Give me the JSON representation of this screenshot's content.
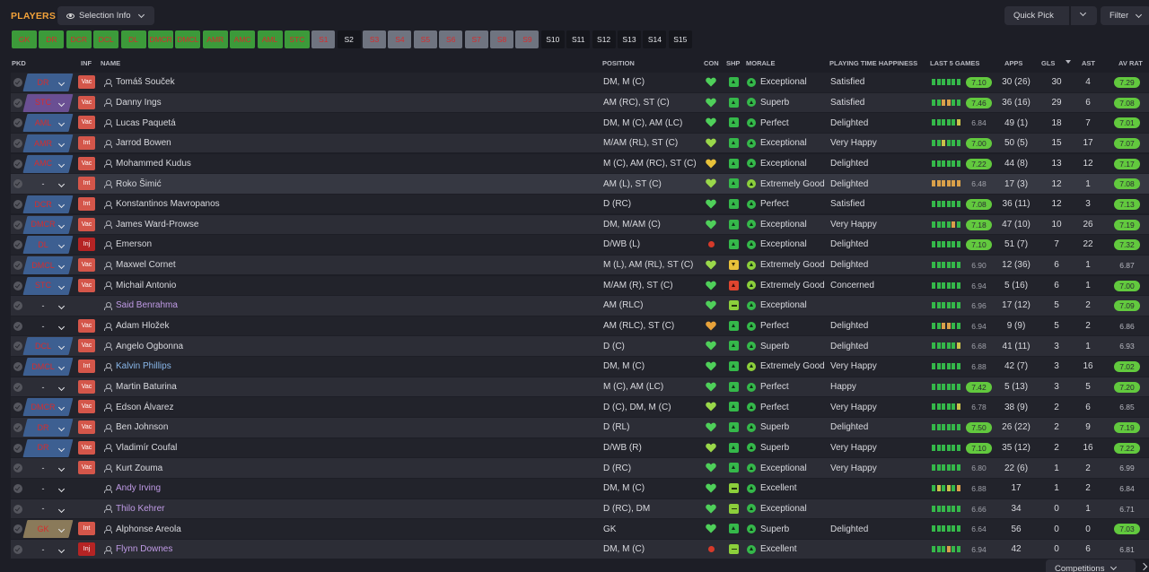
{
  "header": {
    "title": "PLAYERS",
    "selection_info_label": "Selection Info",
    "quick_pick_label": "Quick Pick",
    "filter_label": "Filter",
    "competitions_label": "Competitions"
  },
  "colors": {
    "accent": "#f2a23a",
    "rating_green": "#62c93e",
    "position_blue": "#3d5f91",
    "position_red_text": "#d62d2d",
    "status_red": "#d4564a"
  },
  "slots": [
    {
      "label": "GK",
      "style": "green",
      "w": 28
    },
    {
      "label": "DR",
      "style": "green",
      "w": 28
    },
    {
      "label": "DCR",
      "style": "green",
      "w": 28
    },
    {
      "label": "DCL",
      "style": "green",
      "w": 28
    },
    {
      "label": "DL",
      "style": "green",
      "w": 28
    },
    {
      "label": "DMCR",
      "style": "green",
      "w": 28
    },
    {
      "label": "DMCL",
      "style": "green",
      "w": 28
    },
    {
      "label": "AMR",
      "style": "green",
      "w": 28
    },
    {
      "label": "AMC",
      "style": "green",
      "w": 28
    },
    {
      "label": "AML",
      "style": "green",
      "w": 28
    },
    {
      "label": "STC",
      "style": "green",
      "w": 28
    },
    {
      "label": "S1",
      "style": "grey",
      "w": 26
    },
    {
      "label": "S2",
      "style": "dark",
      "w": 26
    },
    {
      "label": "S3",
      "style": "grey",
      "w": 26
    },
    {
      "label": "S4",
      "style": "grey",
      "w": 26
    },
    {
      "label": "S5",
      "style": "grey",
      "w": 26
    },
    {
      "label": "S6",
      "style": "grey",
      "w": 26
    },
    {
      "label": "S7",
      "style": "grey",
      "w": 26
    },
    {
      "label": "S8",
      "style": "grey",
      "w": 26
    },
    {
      "label": "S9",
      "style": "grey",
      "w": 26
    },
    {
      "label": "S10",
      "style": "dark",
      "w": 26
    },
    {
      "label": "S11",
      "style": "dark",
      "w": 26
    },
    {
      "label": "S12",
      "style": "dark",
      "w": 26
    },
    {
      "label": "S13",
      "style": "dark",
      "w": 26
    },
    {
      "label": "S14",
      "style": "dark",
      "w": 26
    },
    {
      "label": "S15",
      "style": "dark",
      "w": 26
    }
  ],
  "columns": {
    "pkd": "PKD",
    "inf": "INF",
    "name": "NAME",
    "position": "POSITION",
    "con": "CON",
    "shp": "SHP",
    "morale": "MORALE",
    "playing_time": "PLAYING TIME HAPPINESS",
    "last5": "LAST 5 GAMES",
    "apps": "APPS",
    "gls": "GLS",
    "ast": "AST",
    "avrat": "AV RAT"
  },
  "players": [
    {
      "pick": "DR",
      "pick_style": "blue",
      "inf": "Vac",
      "name": "Tomáš Souček",
      "name_style": "",
      "position": "DM, M (C)",
      "heart": "#4fd05a",
      "shp": "g",
      "morale": "Exceptional",
      "pth": "Satisfied",
      "form": "gggggg",
      "l5": "7.10",
      "l5s": "g",
      "apps": "30 (26)",
      "gls": "30",
      "ast": "4",
      "avr": "7.29",
      "avrs": "g"
    },
    {
      "pick": "STC",
      "pick_style": "st",
      "inf": "Vac",
      "name": "Danny Ings",
      "name_style": "",
      "position": "AM (RC), ST (C)",
      "heart": "#4fd05a",
      "shp": "g",
      "morale": "Superb",
      "pth": "Satisfied",
      "form": "ggoogg",
      "l5": "7.46",
      "l5s": "g",
      "apps": "36 (16)",
      "gls": "29",
      "ast": "6",
      "avr": "7.08",
      "avrs": "g"
    },
    {
      "pick": "AML",
      "pick_style": "blue",
      "inf": "Vac",
      "name": "Lucas Paquetá",
      "name_style": "",
      "position": "DM, M (C), AM (LC)",
      "heart": "#4fd05a",
      "shp": "g",
      "morale": "Perfect",
      "pth": "Delighted",
      "form": "gggggy",
      "l5": "6.84",
      "l5s": "n",
      "apps": "49 (1)",
      "gls": "18",
      "ast": "7",
      "avr": "7.01",
      "avrs": "g"
    },
    {
      "pick": "AMR",
      "pick_style": "blue",
      "inf": "Int",
      "name": "Jarrod Bowen",
      "name_style": "",
      "position": "M/AM (RL), ST (C)",
      "heart": "#9ad84a",
      "shp": "g",
      "morale": "Exceptional",
      "pth": "Very Happy",
      "form": "ggyggg",
      "l5": "7.00",
      "l5s": "g",
      "apps": "50 (5)",
      "gls": "15",
      "ast": "17",
      "avr": "7.07",
      "avrs": "g"
    },
    {
      "pick": "AMC",
      "pick_style": "blue",
      "inf": "Vac",
      "name": "Mohammed Kudus",
      "name_style": "",
      "position": "M (C), AM (RC), ST (C)",
      "heart": "#e8c23a",
      "shp": "g",
      "morale": "Exceptional",
      "pth": "Delighted",
      "form": "gggggg",
      "l5": "7.22",
      "l5s": "g",
      "apps": "44 (8)",
      "gls": "13",
      "ast": "12",
      "avr": "7.17",
      "avrs": "g"
    },
    {
      "pick": "-",
      "pick_style": "plain",
      "inf": "Int",
      "name": "Roko Šimić",
      "name_style": "",
      "position": "AM (L), ST (C)",
      "heart": "#9ad84a",
      "shp": "g",
      "morale": "Extremely Good",
      "moraleStyle": "eg",
      "pth": "Delighted",
      "form": "oooooo",
      "l5": "6.48",
      "l5s": "n",
      "apps": "17 (3)",
      "gls": "12",
      "ast": "1",
      "avr": "7.08",
      "avrs": "g",
      "hl": true
    },
    {
      "pick": "DCR",
      "pick_style": "blue",
      "inf": "Int",
      "name": "Konstantinos Mavropanos",
      "name_style": "",
      "position": "D (RC)",
      "heart": "#4fd05a",
      "shp": "g",
      "morale": "Perfect",
      "pth": "Satisfied",
      "form": "gggggg",
      "l5": "7.08",
      "l5s": "g",
      "apps": "36 (11)",
      "gls": "12",
      "ast": "3",
      "avr": "7.13",
      "avrs": "g"
    },
    {
      "pick": "DMCR",
      "pick_style": "blue",
      "inf": "Vac",
      "name": "James Ward-Prowse",
      "name_style": "",
      "position": "DM, M/AM (C)",
      "heart": "#4fd05a",
      "shp": "g",
      "morale": "Exceptional",
      "pth": "Very Happy",
      "form": "ggggog",
      "l5": "7.18",
      "l5s": "g",
      "apps": "47 (10)",
      "gls": "10",
      "ast": "26",
      "avr": "7.19",
      "avrs": "g"
    },
    {
      "pick": "DL",
      "pick_style": "blue",
      "inf": "Inj",
      "name": "Emerson",
      "name_style": "",
      "position": "D/WB (L)",
      "heart": "#d63a2a",
      "shp": "g",
      "morale": "Exceptional",
      "pth": "Delighted",
      "form": "gggggg",
      "l5": "7.10",
      "l5s": "g",
      "apps": "51 (7)",
      "gls": "7",
      "ast": "22",
      "avr": "7.32",
      "avrs": "g",
      "dot": true
    },
    {
      "pick": "DMCL",
      "pick_style": "blue",
      "inf": "Vac",
      "name": "Maxwel Cornet",
      "name_style": "",
      "position": "M (L), AM (RL), ST (C)",
      "heart": "#9ad84a",
      "shp": "y",
      "morale": "Extremely Good",
      "moraleStyle": "eg",
      "pth": "Delighted",
      "form": "gggggg",
      "l5": "6.90",
      "l5s": "n",
      "apps": "12 (36)",
      "gls": "6",
      "ast": "1",
      "avr": "6.87",
      "avrs": "n"
    },
    {
      "pick": "STC",
      "pick_style": "blue",
      "inf": "Vac",
      "name": "Michail Antonio",
      "name_style": "",
      "position": "M/AM (R), ST (C)",
      "heart": "#4fd05a",
      "shp": "r",
      "morale": "Extremely Good",
      "moraleStyle": "eg",
      "pth": "Concerned",
      "form": "gggggg",
      "l5": "6.94",
      "l5s": "n",
      "apps": "5 (16)",
      "gls": "6",
      "ast": "1",
      "avr": "7.00",
      "avrs": "g"
    },
    {
      "pick": "-",
      "pick_style": "plain",
      "inf": "",
      "name": "Said Benrahma",
      "name_style": "loan",
      "position": "AM (RLC)",
      "heart": "#4fd05a",
      "shp": "m",
      "morale": "Exceptional",
      "pth": "",
      "form": "gggggg",
      "l5": "6.96",
      "l5s": "n",
      "apps": "17 (12)",
      "gls": "5",
      "ast": "2",
      "avr": "7.09",
      "avrs": "g"
    },
    {
      "pick": "-",
      "pick_style": "plain",
      "inf": "Vac",
      "name": "Adam Hložek",
      "name_style": "",
      "position": "AM (RLC), ST (C)",
      "heart": "#e8a23a",
      "shp": "g",
      "morale": "Perfect",
      "pth": "Delighted",
      "form": "ggoogg",
      "l5": "6.94",
      "l5s": "n",
      "apps": "9 (9)",
      "gls": "5",
      "ast": "2",
      "avr": "6.86",
      "avrs": "n"
    },
    {
      "pick": "DCL",
      "pick_style": "blue",
      "inf": "Vac",
      "name": "Angelo Ogbonna",
      "name_style": "",
      "position": "D (C)",
      "heart": "#4fd05a",
      "shp": "g",
      "morale": "Superb",
      "pth": "Delighted",
      "form": "gggggy",
      "l5": "6.68",
      "l5s": "n",
      "apps": "41 (11)",
      "gls": "3",
      "ast": "1",
      "avr": "6.93",
      "avrs": "n"
    },
    {
      "pick": "DMCL",
      "pick_style": "blue",
      "inf": "Int",
      "name": "Kalvin Phillips",
      "name_style": "blue",
      "position": "DM, M (C)",
      "heart": "#4fd05a",
      "shp": "g",
      "morale": "Extremely Good",
      "moraleStyle": "eg",
      "pth": "Very Happy",
      "form": "gggggg",
      "l5": "6.88",
      "l5s": "n",
      "apps": "42 (7)",
      "gls": "3",
      "ast": "16",
      "avr": "7.02",
      "avrs": "g"
    },
    {
      "pick": "-",
      "pick_style": "plain",
      "inf": "Vac",
      "name": "Martin Baturina",
      "name_style": "",
      "position": "M (C), AM (LC)",
      "heart": "#4fd05a",
      "shp": "g",
      "morale": "Perfect",
      "pth": "Happy",
      "form": "gggggg",
      "l5": "7.42",
      "l5s": "g",
      "apps": "5 (13)",
      "gls": "3",
      "ast": "5",
      "avr": "7.20",
      "avrs": "g"
    },
    {
      "pick": "DMCR",
      "pick_style": "blue",
      "inf": "Vac",
      "name": "Edson Álvarez",
      "name_style": "",
      "position": "D (C), DM, M (C)",
      "heart": "#9ad84a",
      "shp": "g",
      "morale": "Perfect",
      "pth": "Very Happy",
      "form": "gggggy",
      "l5": "6.78",
      "l5s": "n",
      "apps": "38 (9)",
      "gls": "2",
      "ast": "6",
      "avr": "6.85",
      "avrs": "n"
    },
    {
      "pick": "DR",
      "pick_style": "blue",
      "inf": "Vac",
      "name": "Ben Johnson",
      "name_style": "",
      "position": "D (RL)",
      "heart": "#4fd05a",
      "shp": "g",
      "morale": "Superb",
      "pth": "Delighted",
      "form": "gggggg",
      "l5": "7.50",
      "l5s": "g",
      "apps": "26 (22)",
      "gls": "2",
      "ast": "9",
      "avr": "7.19",
      "avrs": "g"
    },
    {
      "pick": "DR",
      "pick_style": "blue",
      "inf": "Vac",
      "name": "Vladimír Coufal",
      "name_style": "",
      "position": "D/WB (R)",
      "heart": "#9ad84a",
      "shp": "g",
      "morale": "Superb",
      "pth": "Very Happy",
      "form": "gggggg",
      "l5": "7.10",
      "l5s": "g",
      "apps": "35 (12)",
      "gls": "2",
      "ast": "16",
      "avr": "7.22",
      "avrs": "g"
    },
    {
      "pick": "-",
      "pick_style": "plain",
      "inf": "Vac",
      "name": "Kurt Zouma",
      "name_style": "",
      "position": "D (RC)",
      "heart": "#4fd05a",
      "shp": "g",
      "morale": "Exceptional",
      "pth": "Very Happy",
      "form": "gggggg",
      "l5": "6.80",
      "l5s": "n",
      "apps": "22 (6)",
      "gls": "1",
      "ast": "2",
      "avr": "6.99",
      "avrs": "n"
    },
    {
      "pick": "-",
      "pick_style": "plain",
      "inf": "",
      "name": "Andy Irving",
      "name_style": "loan",
      "position": "DM, M (C)",
      "heart": "#4fd05a",
      "shp": "m",
      "morale": "Excellent",
      "pth": "",
      "form": "gygygo",
      "l5": "6.88",
      "l5s": "n",
      "apps": "17",
      "gls": "1",
      "ast": "2",
      "avr": "6.84",
      "avrs": "n"
    },
    {
      "pick": "-",
      "pick_style": "plain",
      "inf": "",
      "name": "Thilo Kehrer",
      "name_style": "loan",
      "position": "D (RC), DM",
      "heart": "#4fd05a",
      "shp": "m",
      "morale": "Exceptional",
      "pth": "",
      "form": "gggggg",
      "l5": "6.66",
      "l5s": "n",
      "apps": "34",
      "gls": "0",
      "ast": "1",
      "avr": "6.71",
      "avrs": "n"
    },
    {
      "pick": "GK",
      "pick_style": "gk",
      "inf": "Int",
      "name": "Alphonse Areola",
      "name_style": "",
      "position": "GK",
      "heart": "#4fd05a",
      "shp": "g",
      "morale": "Superb",
      "pth": "Delighted",
      "form": "gggggg",
      "l5": "6.64",
      "l5s": "n",
      "apps": "56",
      "gls": "0",
      "ast": "0",
      "avr": "7.03",
      "avrs": "g"
    },
    {
      "pick": "-",
      "pick_style": "plain",
      "inf": "Inj",
      "name": "Flynn Downes",
      "name_style": "loan",
      "position": "DM, M (C)",
      "heart": "#d63a2a",
      "shp": "m",
      "morale": "Excellent",
      "pth": "",
      "form": "gggogg",
      "l5": "6.94",
      "l5s": "n",
      "apps": "42",
      "gls": "0",
      "ast": "6",
      "avr": "6.81",
      "avrs": "n",
      "dot": true
    }
  ]
}
